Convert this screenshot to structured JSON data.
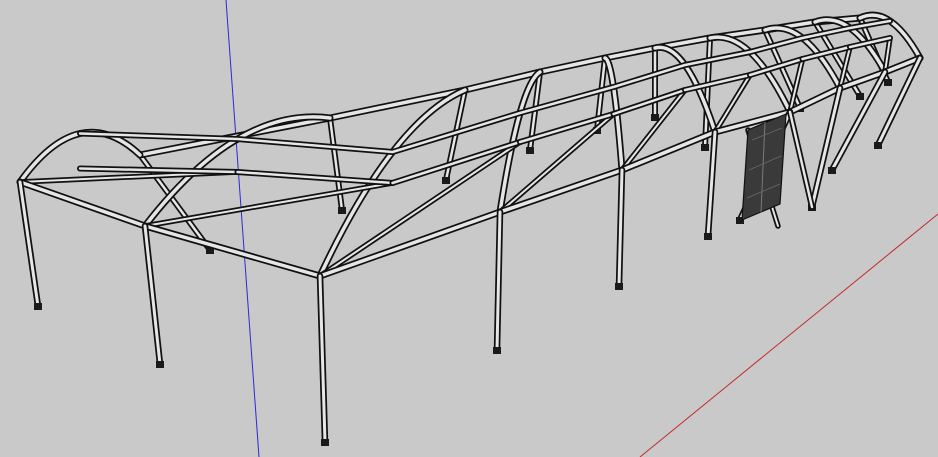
{
  "viewport": {
    "background_color": "#c9c9c9",
    "axis_colors": {
      "blue_axis": "#2a2ad8",
      "red_axis": "#c42a2a"
    },
    "frame_colors": {
      "outline": "#111111",
      "fill": "#e6e6e6",
      "door_panel": "#3a3a3a"
    }
  }
}
